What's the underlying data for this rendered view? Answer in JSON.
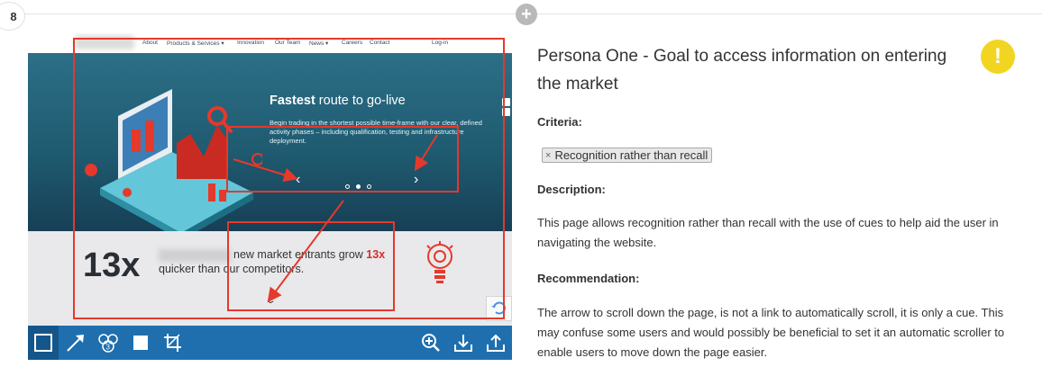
{
  "step": {
    "number": "8"
  },
  "add_button": {
    "icon": "plus-icon",
    "symbol": "+"
  },
  "site": {
    "nav": {
      "items": [
        "About",
        "Products & Services ▾",
        "Innovation",
        "Our Team",
        "News ▾",
        "Careers",
        "Contact"
      ],
      "login": "Log-in"
    },
    "hero": {
      "title_bold": "Fastest",
      "title_rest": " route to go-live",
      "body": "Begin trading in the shortest possible time-frame with our clear, defined activity phases – including qualification, testing and infrastructure deployment."
    },
    "carousel": {
      "prev": "‹",
      "next": "›"
    },
    "stat": {
      "big": "13x",
      "line1_pre": "new market entrants grow ",
      "line1_accent": "13x",
      "line2": "quicker than our competitors."
    },
    "scroll_cue": "⌄"
  },
  "toolbar": {
    "tools": [
      "rectangle-tool",
      "arrow-tool",
      "numbered-marker-tool",
      "filled-rect-tool",
      "crop-tool",
      "zoom-in-tool",
      "download-tool",
      "upload-tool"
    ]
  },
  "finding": {
    "title": "Persona One - Goal to access information on entering the market",
    "severity_icon": "!",
    "severity_color": "#f2d521",
    "criteria_label": "Criteria:",
    "criteria_tag": "Recognition rather than recall",
    "tag_remove": "×",
    "description_label": "Description:",
    "description": "This page allows recognition rather than recall with the use of cues to help aid the user in navigating the website.",
    "recommendation_label": "Recommendation:",
    "recommendation": "The arrow to scroll down the page, is not a link to automatically scroll, it is only a cue. This may confuse some users and would possibly be beneficial to set it an automatic scroller to enable users to move down the page easier."
  },
  "colors": {
    "annotation": "#e5392b",
    "toolbar": "#1f6fae",
    "accent": "#d62c2c"
  }
}
